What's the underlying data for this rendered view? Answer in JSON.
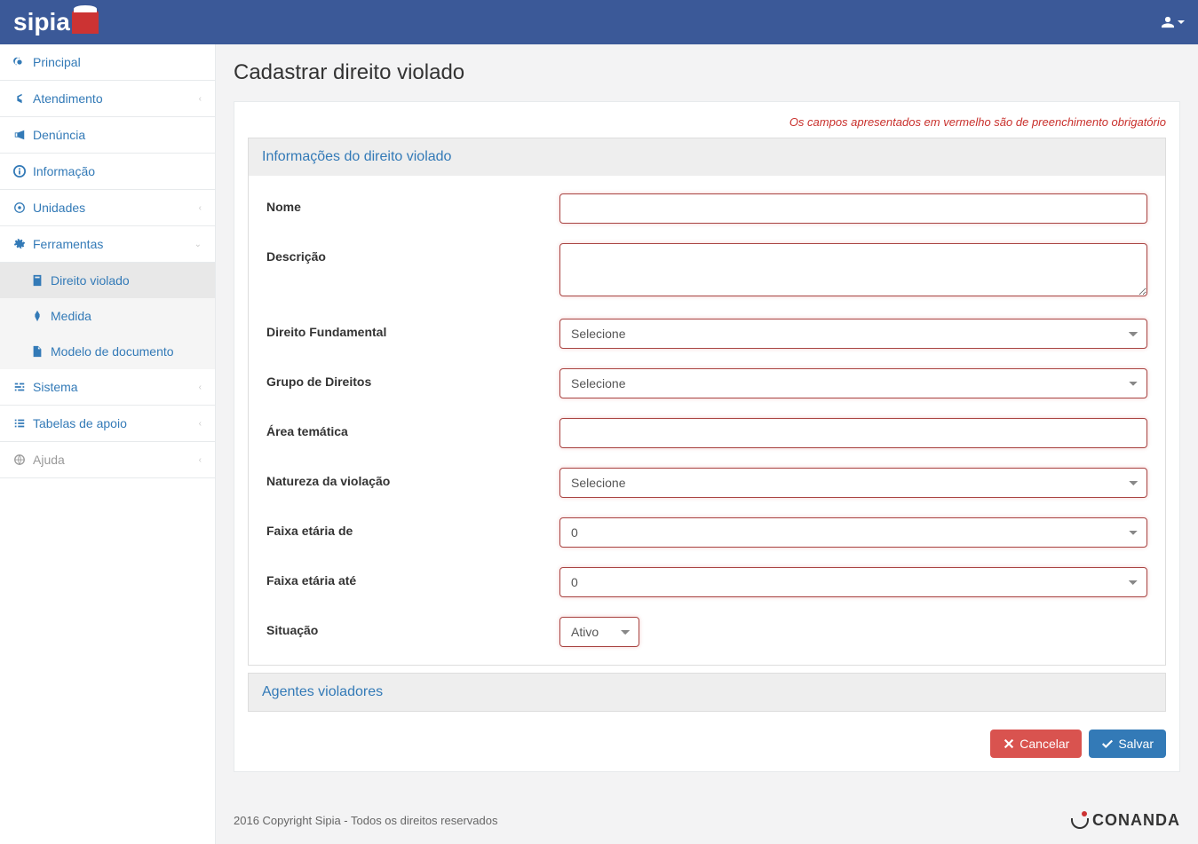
{
  "brand": "sipia",
  "page_title": "Cadastrar direito violado",
  "required_note": "Os campos apresentados em vermelho são de preenchimento obrigatório",
  "sidebar": {
    "principal": "Principal",
    "atendimento": "Atendimento",
    "denuncia": "Denúncia",
    "informacao": "Informação",
    "unidades": "Unidades",
    "ferramentas": "Ferramentas",
    "direito_violado": "Direito violado",
    "medida": "Medida",
    "modelo_documento": "Modelo de documento",
    "sistema": "Sistema",
    "tabelas_apoio": "Tabelas de apoio",
    "ajuda": "Ajuda"
  },
  "panels": {
    "info": "Informações do direito violado",
    "agentes": "Agentes violadores"
  },
  "form": {
    "nome_label": "Nome",
    "nome_value": "",
    "descricao_label": "Descrição",
    "descricao_value": "",
    "direito_fundamental_label": "Direito Fundamental",
    "direito_fundamental_value": "Selecione",
    "grupo_direitos_label": "Grupo de Direitos",
    "grupo_direitos_value": "Selecione",
    "area_tematica_label": "Área temática",
    "area_tematica_value": "",
    "natureza_violacao_label": "Natureza da violação",
    "natureza_violacao_value": "Selecione",
    "faixa_de_label": "Faixa etária de",
    "faixa_de_value": "0",
    "faixa_ate_label": "Faixa etária até",
    "faixa_ate_value": "0",
    "situacao_label": "Situação",
    "situacao_value": "Ativo"
  },
  "buttons": {
    "cancelar": "Cancelar",
    "salvar": "Salvar"
  },
  "footer": {
    "copyright": "2016 Copyright Sipia - Todos os direitos reservados",
    "partner": "CONANDA"
  }
}
